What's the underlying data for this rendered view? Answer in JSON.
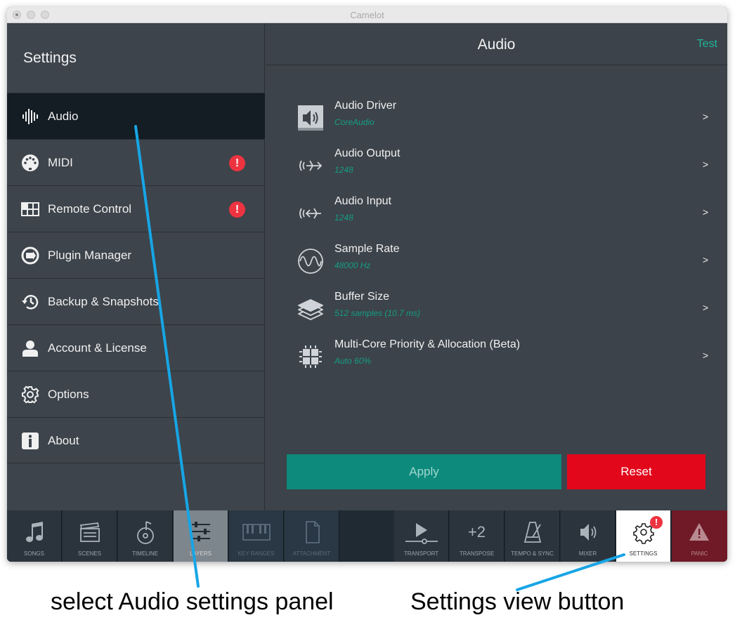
{
  "window": {
    "title": "Camelot"
  },
  "sidebar": {
    "title": "Settings",
    "items": [
      {
        "label": "Audio",
        "icon": "audio-waveform-icon",
        "active": true,
        "alert": false
      },
      {
        "label": "MIDI",
        "icon": "midi-connector-icon",
        "active": false,
        "alert": true
      },
      {
        "label": "Remote Control",
        "icon": "remote-control-grid-icon",
        "active": false,
        "alert": true
      },
      {
        "label": "Plugin Manager",
        "icon": "plugin-icon",
        "active": false,
        "alert": false
      },
      {
        "label": "Backup & Snapshots",
        "icon": "history-icon",
        "active": false,
        "alert": false
      },
      {
        "label": "Account & License",
        "icon": "user-icon",
        "active": false,
        "alert": false
      },
      {
        "label": "Options",
        "icon": "gear-icon",
        "active": false,
        "alert": false
      },
      {
        "label": "About",
        "icon": "info-icon",
        "active": false,
        "alert": false
      }
    ],
    "alert_glyph": "!"
  },
  "main": {
    "title": "Audio",
    "test_label": "Test",
    "arrow": ">",
    "settings": [
      {
        "label": "Audio Driver",
        "value": "CoreAudio",
        "icon": "speaker-icon"
      },
      {
        "label": "Audio Output",
        "value": "1248",
        "icon": "audio-output-icon"
      },
      {
        "label": "Audio Input",
        "value": "1248",
        "icon": "audio-input-icon"
      },
      {
        "label": "Sample Rate",
        "value": "48000 Hz",
        "icon": "sine-wave-icon"
      },
      {
        "label": "Buffer Size",
        "value": "512 samples (10.7 ms)",
        "icon": "layers-stack-icon"
      },
      {
        "label": "Multi-Core Priority & Allocation (Beta)",
        "value": "Auto 60%",
        "icon": "cpu-chip-icon"
      }
    ],
    "apply_label": "Apply",
    "reset_label": "Reset"
  },
  "toolbar": {
    "buttons": [
      {
        "label": "SONGS",
        "icon": "music-note-icon"
      },
      {
        "label": "SCENES",
        "icon": "clapperboard-icon"
      },
      {
        "label": "TIMELINE",
        "icon": "timeline-disc-icon"
      },
      {
        "label": "LAYERS",
        "icon": "sliders-icon"
      },
      {
        "label": "KEY RANGES",
        "icon": "piano-keys-icon"
      },
      {
        "label": "ATTACHMENT",
        "icon": "document-icon"
      },
      {
        "label": "TRANSPORT",
        "icon": "play-icon"
      },
      {
        "label": "TRANSPOSE",
        "icon": "transpose-icon",
        "text": "+2"
      },
      {
        "label": "TEMPO & SYNC",
        "icon": "metronome-icon"
      },
      {
        "label": "MIXER",
        "icon": "speaker-icon"
      },
      {
        "label": "SETTINGS",
        "icon": "gear-icon",
        "alert": "!"
      },
      {
        "label": "PANIC",
        "icon": "warning-triangle-icon"
      }
    ]
  },
  "annotations": {
    "left_caption": "select Audio settings panel",
    "right_caption": "Settings view button"
  },
  "colors": {
    "accent_teal": "#0d8a7c",
    "value_teal": "#159d84",
    "reset_red": "#e2071b",
    "alert_red": "#ee3340",
    "pointer_blue": "#17a5e5"
  }
}
